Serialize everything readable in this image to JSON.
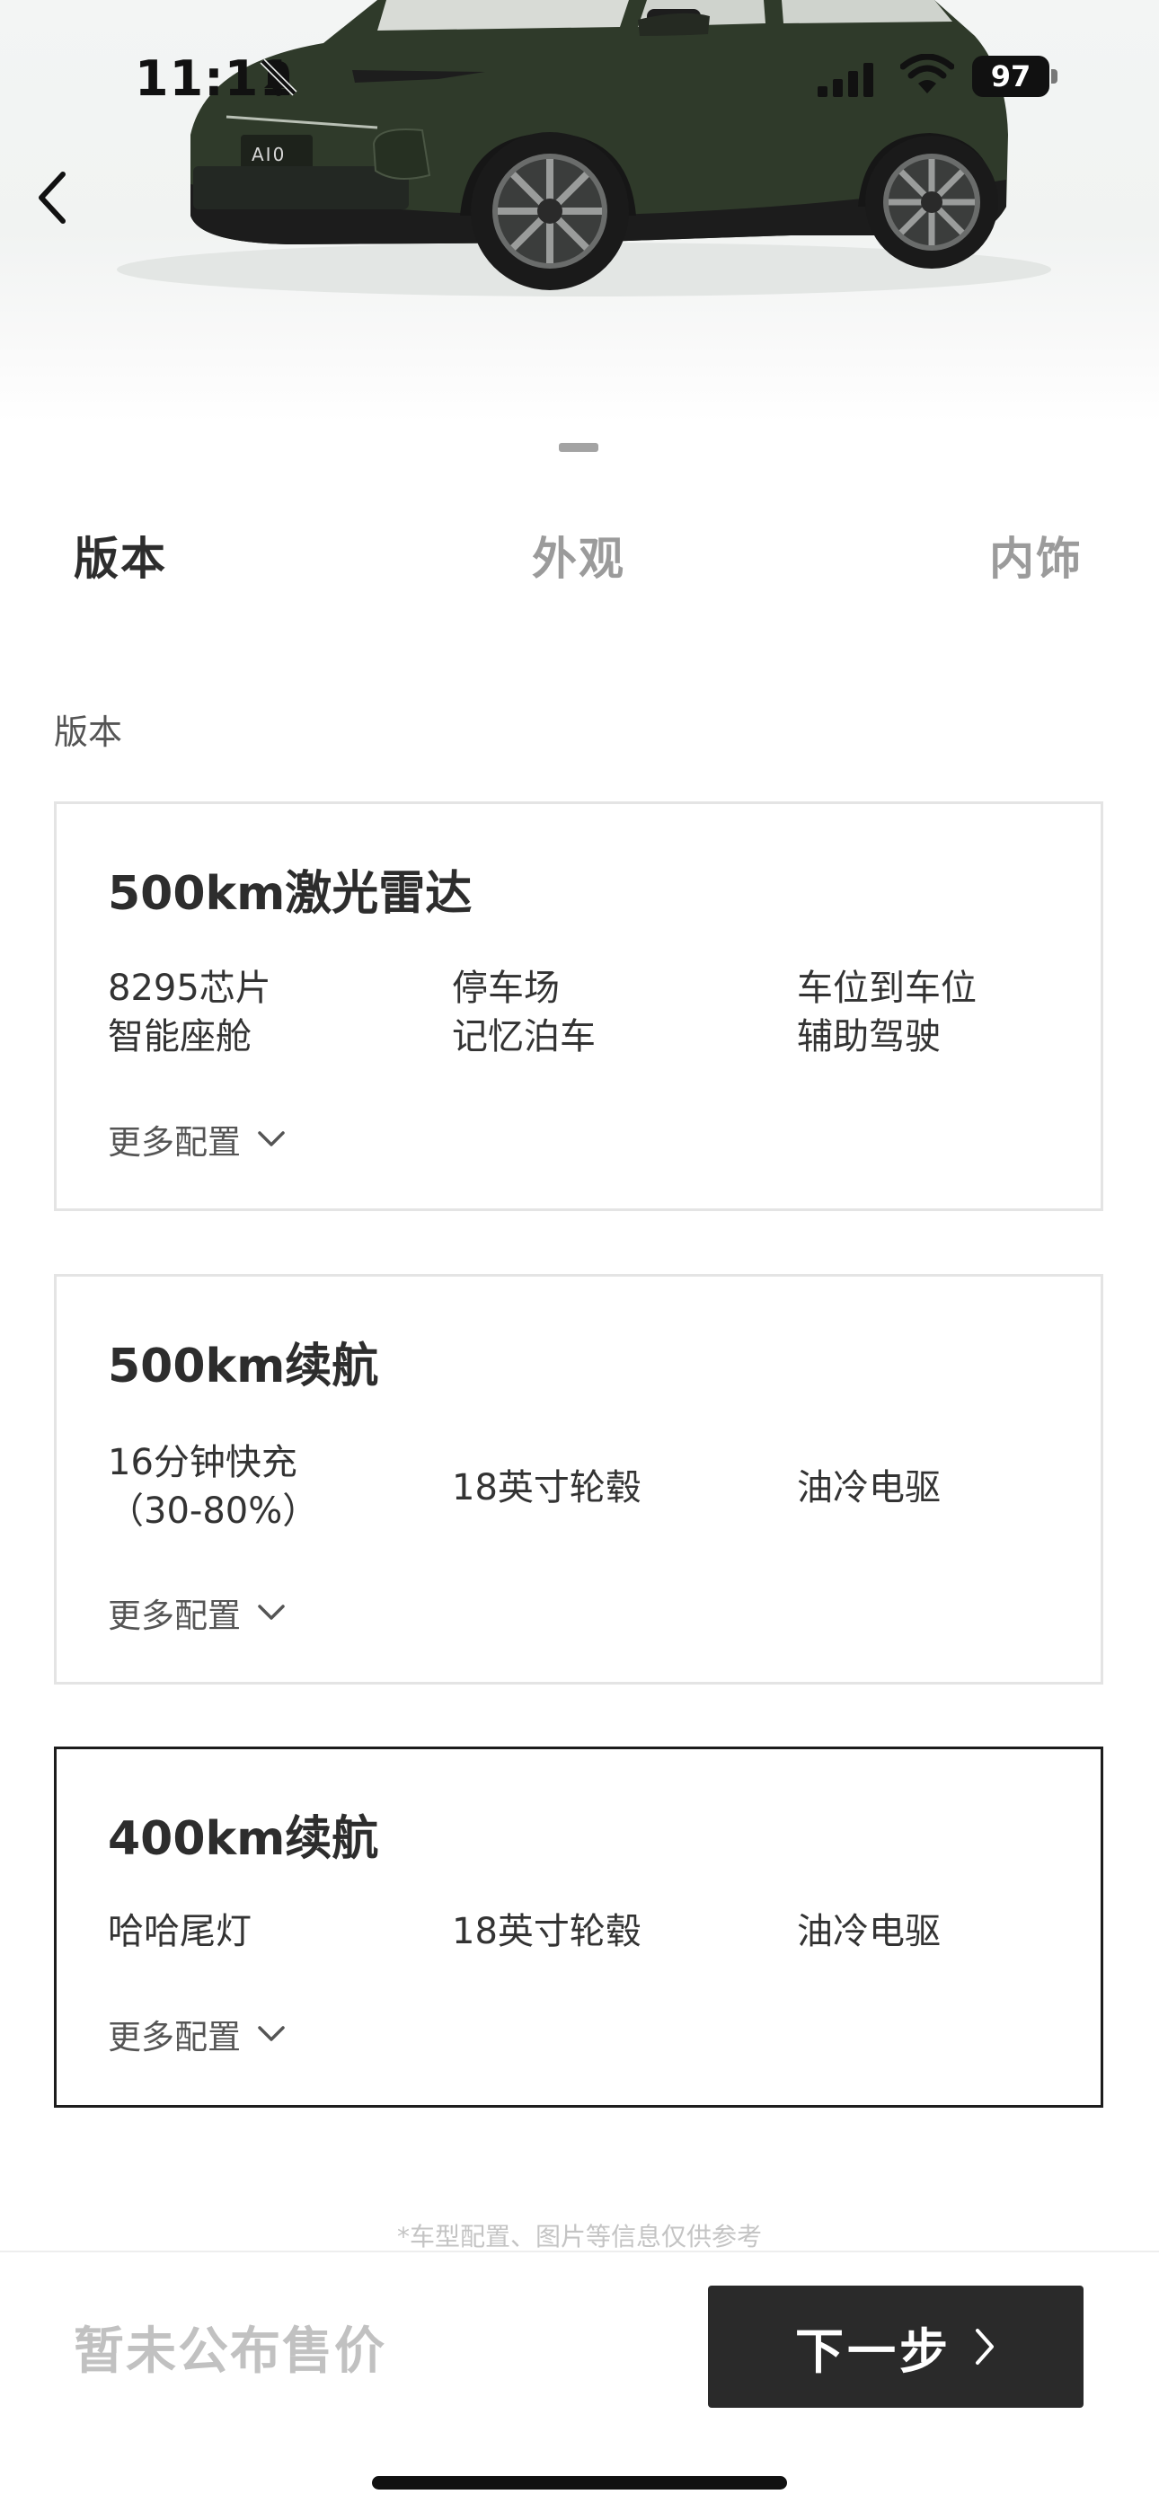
{
  "status_bar": {
    "time": "11:11",
    "battery": "97"
  },
  "hero": {
    "badge": "AI0"
  },
  "tabs": [
    {
      "label": "版本",
      "active": true
    },
    {
      "label": "外观",
      "active": false
    },
    {
      "label": "内饰",
      "active": false
    }
  ],
  "section_label": "版本",
  "versions": [
    {
      "title": "500km激光雷达",
      "features": [
        {
          "line1": "8295芯片",
          "line2": "智能座舱"
        },
        {
          "line1": "停车场",
          "line2": "记忆泊车"
        },
        {
          "line1": "车位到车位",
          "line2": "辅助驾驶"
        }
      ],
      "more": "更多配置",
      "selected": false
    },
    {
      "title": "500km续航",
      "features": [
        {
          "line1": "16分钟快充",
          "line2": "（30-80%）"
        },
        {
          "line1": "18英寸轮毂"
        },
        {
          "line1": "油冷电驱"
        }
      ],
      "more": "更多配置",
      "selected": false
    },
    {
      "title": "400km续航",
      "features": [
        {
          "line1": "哈哈尾灯"
        },
        {
          "line1": "18英寸轮毂"
        },
        {
          "line1": "油冷电驱"
        }
      ],
      "more": "更多配置",
      "selected": true
    }
  ],
  "disclaimer": "*车型配置、图片等信息仅供参考",
  "footer": {
    "price": "暂未公布售价",
    "next_label": "下一步"
  },
  "colors": {
    "primary_button": "#2a2a2a",
    "car_body": "#2f3a2a",
    "selected_border": "#1d1d1d"
  }
}
